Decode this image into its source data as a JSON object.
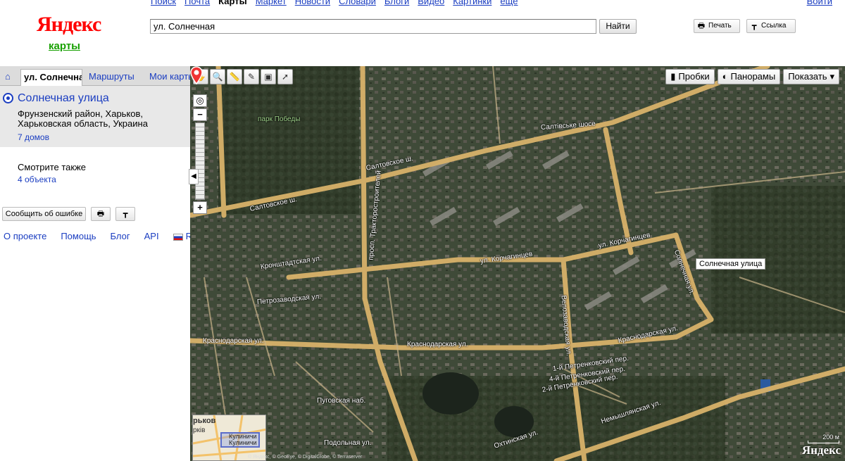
{
  "header": {
    "logo_main": "Яндекс",
    "logo_sub": "карты",
    "services": [
      {
        "label": "Поиск",
        "active": false
      },
      {
        "label": "Почта",
        "active": false
      },
      {
        "label": "Карты",
        "active": true
      },
      {
        "label": "Маркет",
        "active": false
      },
      {
        "label": "Новости",
        "active": false
      },
      {
        "label": "Словари",
        "active": false
      },
      {
        "label": "Блоги",
        "active": false
      },
      {
        "label": "Видео",
        "active": false
      },
      {
        "label": "Картинки",
        "active": false
      },
      {
        "label": "ещё",
        "active": false
      }
    ],
    "login": "Войти",
    "search": {
      "value": "ул. Солнечная",
      "button": "Найти"
    },
    "print_label": "Печать",
    "link_label": "Ссылка"
  },
  "sidebar": {
    "tabs": {
      "home_icon": "home-icon",
      "search": "ул. Солнечная",
      "routes": "Маршруты",
      "my_maps": "Мои карты"
    },
    "result": {
      "title": "Солнечная улица",
      "address": "Фрунзенский район, Харьков, Харьковская область, Украина",
      "count": "7 домов"
    },
    "see_also": {
      "label": "Смотрите также",
      "link": "4 объекта"
    },
    "report_button": "Сообщить об ошибке",
    "footer": {
      "about": "О проекте",
      "help": "Помощь",
      "blog": "Блог",
      "api": "API",
      "lang": "R"
    }
  },
  "map": {
    "controls": {
      "traffic": "Пробки",
      "panoramas": "Панорамы",
      "show": "Показать"
    },
    "marker_label": "Солнечная улица",
    "roads": {
      "saltovskoe": "Салтовское ш.",
      "saltivske": "Салтівське шосе",
      "korchagintsev": "ул. Корчагинцев",
      "krasnodarskaya": "Краснодарская ул.",
      "nemyshlyanskaya": "Немышлянская ул.",
      "velozavodskaya": "Велозаводская ул.",
      "traktorostroiteley": "просп. Тракторостроителей",
      "solnechnaya": "Солнечная ул.",
      "petrenkovsky1": "1-й Петренковский пер.",
      "petrenkovsky2": "2-й Петренковский пер.",
      "petrenkovsky4": "4-й Петренковский пер.",
      "okhtinskaya": "Охтинская ул.",
      "podolnaya": "Подольная ул.",
      "pugovskaya": "Пуговская наб.",
      "kronshtadtskaya": "Кронштадтская ул.",
      "petrozavodskaya": "Петрозаводская ул.",
      "park": "парк Победы"
    },
    "minimap": {
      "city": "рьков",
      "city2": "ркiв",
      "area": "Кулиничи"
    },
    "scale": "200 м",
    "logo": "Яндекс",
    "copyright": "© Яндекс, © GeoEye, © DigitalGlobe, © Terraserver"
  }
}
